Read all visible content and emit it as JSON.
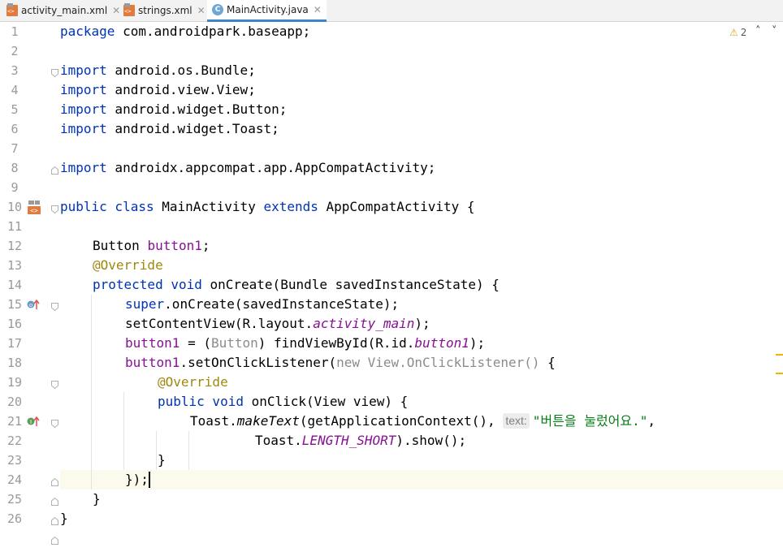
{
  "tabs": [
    {
      "label": "activity_main.xml",
      "icon": "xml-file-icon"
    },
    {
      "label": "strings.xml",
      "icon": "xml-file-icon"
    },
    {
      "label": "MainActivity.java",
      "icon": "java-class-icon",
      "active": true
    }
  ],
  "inspection": {
    "warning_count": "2"
  },
  "editor": {
    "line_numbers": [
      "1",
      "2",
      "3",
      "4",
      "5",
      "6",
      "7",
      "8",
      "9",
      "10",
      "11",
      "12",
      "13",
      "14",
      "15",
      "16",
      "17",
      "18",
      "19",
      "20",
      "21",
      "22",
      "23",
      "24",
      "25",
      "26"
    ],
    "code": {
      "l1_kw": "package",
      "l1_rest": " com.androidpark.baseapp;",
      "l3_kw": "import",
      "l3_rest": " android.os.Bundle;",
      "l4_kw": "import",
      "l4_rest": " android.view.View;",
      "l5_kw": "import",
      "l5_rest": " android.widget.Button;",
      "l6_kw": "import",
      "l6_rest": " android.widget.Toast;",
      "l8_kw": "import",
      "l8_rest": " androidx.appcompat.app.AppCompatActivity;",
      "l10_kw1": "public class",
      "l10_mid": " MainActivity ",
      "l10_kw2": "extends",
      "l10_rest": " AppCompatActivity {",
      "l12_type": "Button ",
      "l12_field": "button1",
      "l12_end": ";",
      "l13_ann": "@Override",
      "l14_kw": "protected void",
      "l14_rest": " onCreate(Bundle savedInstanceState) {",
      "l15_kw": "super",
      "l15_rest": ".onCreate(savedInstanceState);",
      "l16_a": "setContentView(R.layout.",
      "l16_field": "activity_main",
      "l16_end": ");",
      "l17_field": "button1",
      "l17_a": " = (",
      "l17_gray": "Button",
      "l17_b": ") findViewById(R.id.",
      "l17_field2": "button1",
      "l17_end": ");",
      "l18_field": "button1",
      "l18_a": ".setOnClickListener(",
      "l18_gray": "new View.OnClickListener()",
      "l18_end": " {",
      "l19_ann": "@Override",
      "l20_kw": "public void",
      "l20_rest": " onClick(View view) {",
      "l21_a": "Toast.",
      "l21_method": "makeText",
      "l21_b": "(getApplicationContext(),",
      "l21_hint": "text:",
      "l21_str": "\"버튼을 눌렀어요.\"",
      "l21_end": ",",
      "l22_a": "Toast.",
      "l22_field": "LENGTH_SHORT",
      "l22_end": ").show();",
      "l23": "}",
      "l24": "});",
      "l25": "}",
      "l26": "}"
    }
  },
  "gutter_icons": [
    {
      "line": "10",
      "icon": "layout-file-icon"
    },
    {
      "line": "14",
      "icon": "override-method-icon"
    },
    {
      "line": "20",
      "icon": "implement-method-icon"
    }
  ]
}
